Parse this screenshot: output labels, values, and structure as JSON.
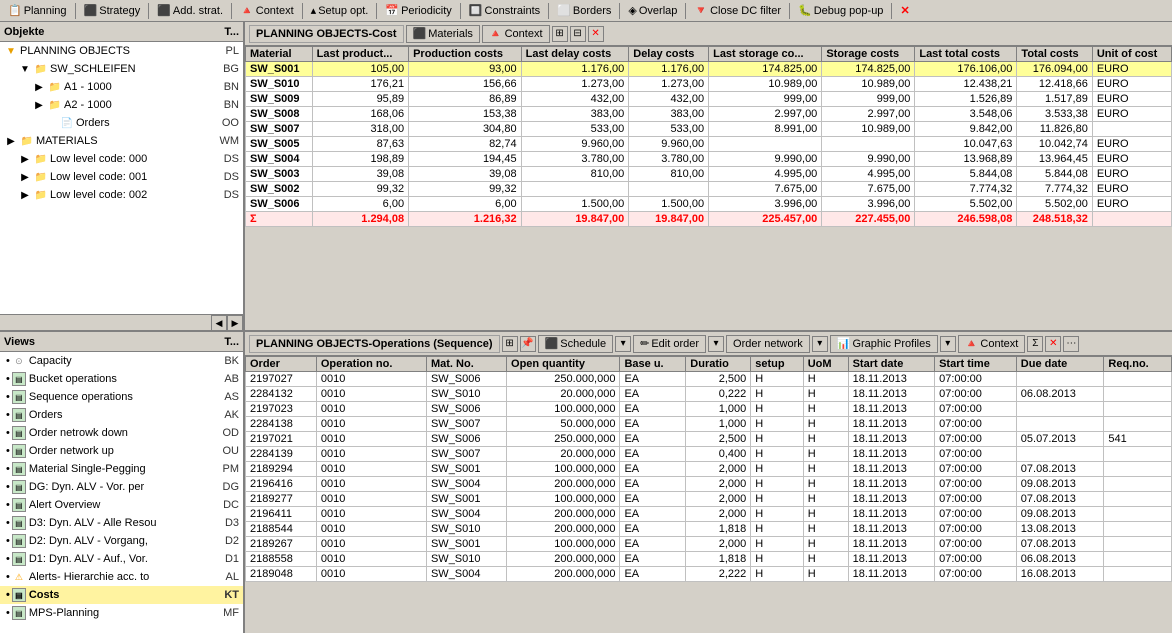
{
  "toolbar": {
    "items": [
      {
        "label": "Planning",
        "icon": "📋"
      },
      {
        "label": "Strategy",
        "icon": "📊"
      },
      {
        "label": "Add. strat.",
        "icon": "📑"
      },
      {
        "label": "Context",
        "icon": "🔺"
      },
      {
        "label": "Setup opt.",
        "icon": "🔺"
      },
      {
        "label": "Periodicity",
        "icon": "📅"
      },
      {
        "label": "Constraints",
        "icon": "🔲"
      },
      {
        "label": "Borders",
        "icon": "⬜"
      },
      {
        "label": "Overlap",
        "icon": "◈"
      },
      {
        "label": "Close DC filter",
        "icon": "🔻"
      },
      {
        "label": "Debug pop-up",
        "icon": "🐛"
      }
    ]
  },
  "left_panel": {
    "objects_header": "Objekte",
    "objects_col": "T...",
    "tree": [
      {
        "label": "PLANNING OBJECTS",
        "code": "PL",
        "indent": 0,
        "type": "root",
        "expanded": true
      },
      {
        "label": "SW_SCHLEIFEN",
        "code": "BG",
        "indent": 1,
        "type": "folder",
        "expanded": true
      },
      {
        "label": "A1 - 1000",
        "code": "BN",
        "indent": 2,
        "type": "folder"
      },
      {
        "label": "A2 - 1000",
        "code": "BN",
        "indent": 2,
        "type": "folder"
      },
      {
        "label": "Orders",
        "code": "OO",
        "indent": 3,
        "type": "orders"
      },
      {
        "label": "MATERIALS",
        "code": "WM",
        "indent": 0,
        "type": "folder",
        "expanded": false
      },
      {
        "label": "Low level code: 000",
        "code": "DS",
        "indent": 1,
        "type": "folder"
      },
      {
        "label": "Low level code: 001",
        "code": "DS",
        "indent": 1,
        "type": "folder"
      },
      {
        "label": "Low level code: 002",
        "code": "DS",
        "indent": 1,
        "type": "folder"
      }
    ],
    "views_header": "Views",
    "views_col": "T...",
    "views": [
      {
        "label": "Capacity",
        "code": "BK",
        "type": "chart",
        "selected": false
      },
      {
        "label": "Bucket operations",
        "code": "AB",
        "type": "doc",
        "selected": false
      },
      {
        "label": "Sequence operations",
        "code": "AS",
        "type": "doc"
      },
      {
        "label": "Orders",
        "code": "AK",
        "type": "doc"
      },
      {
        "label": "Order netrowk down",
        "code": "OD",
        "type": "doc"
      },
      {
        "label": "Order network up",
        "code": "OU",
        "type": "doc"
      },
      {
        "label": "Material Single-Pegging",
        "code": "PM",
        "type": "doc"
      },
      {
        "label": "DG: Dyn. ALV - Vor. per",
        "code": "DG",
        "type": "doc"
      },
      {
        "label": "Alert Overview",
        "code": "DC",
        "type": "doc"
      },
      {
        "label": "D3: Dyn. ALV - Alle Resou",
        "code": "D3",
        "type": "doc"
      },
      {
        "label": "D2: Dyn. ALV - Vorgang,",
        "code": "D2",
        "type": "doc"
      },
      {
        "label": "D1: Dyn. ALV - Auf., Vor.",
        "code": "D1",
        "type": "doc"
      },
      {
        "label": "Alerts- Hierarchie acc. to",
        "code": "AL",
        "type": "warn"
      },
      {
        "label": "Costs",
        "code": "KT",
        "type": "doc",
        "selected": true
      },
      {
        "label": "MPS-Planning",
        "code": "MF",
        "type": "doc"
      }
    ]
  },
  "top_table": {
    "toolbar_title": "PLANNING OBJECTS-Cost",
    "btn_materials": "Materials",
    "btn_context": "Context",
    "columns": [
      "Material",
      "Last product...",
      "Production costs",
      "Last delay costs",
      "Delay costs",
      "Last storage co...",
      "Storage costs",
      "Last total costs",
      "Total costs",
      "Unit of cost"
    ],
    "rows": [
      {
        "mat": "SW_S001",
        "last_prod": "105,00",
        "prod_costs": "93,00",
        "last_delay": "1.176,00",
        "delay": "1.176,00",
        "last_storage": "174.825,00",
        "storage": "174.825,00",
        "last_total": "176.106,00",
        "total": "176.094,00",
        "unit": "EURO",
        "selected": true
      },
      {
        "mat": "SW_S010",
        "last_prod": "176,21",
        "prod_costs": "156,66",
        "last_delay": "1.273,00",
        "delay": "1.273,00",
        "last_storage": "10.989,00",
        "storage": "10.989,00",
        "last_total": "12.438,21",
        "total": "12.418,66",
        "unit": "EURO"
      },
      {
        "mat": "SW_S009",
        "last_prod": "95,89",
        "prod_costs": "86,89",
        "last_delay": "432,00",
        "delay": "432,00",
        "last_storage": "999,00",
        "storage": "999,00",
        "last_total": "1.526,89",
        "total": "1.517,89",
        "unit": "EURO"
      },
      {
        "mat": "SW_S008",
        "last_prod": "168,06",
        "prod_costs": "153,38",
        "last_delay": "383,00",
        "delay": "383,00",
        "last_storage": "2.997,00",
        "storage": "2.997,00",
        "last_total": "3.548,06",
        "total": "3.533,38",
        "unit": "EURO"
      },
      {
        "mat": "SW_S007",
        "last_prod": "318,00",
        "prod_costs": "304,80",
        "last_delay": "533,00",
        "delay": "533,00",
        "last_storage": "8.991,00",
        "storage": "10.989,00",
        "last_total": "9.842,00",
        "total": "11.826,80",
        "unit": ""
      },
      {
        "mat": "SW_S005",
        "last_prod": "87,63",
        "prod_costs": "82,74",
        "last_delay": "9.960,00",
        "delay": "9.960,00",
        "last_storage": "",
        "storage": "",
        "last_total": "10.047,63",
        "total": "10.042,74",
        "unit": "EURO"
      },
      {
        "mat": "SW_S004",
        "last_prod": "198,89",
        "prod_costs": "194,45",
        "last_delay": "3.780,00",
        "delay": "3.780,00",
        "last_storage": "9.990,00",
        "storage": "9.990,00",
        "last_total": "13.968,89",
        "total": "13.964,45",
        "unit": "EURO"
      },
      {
        "mat": "SW_S003",
        "last_prod": "39,08",
        "prod_costs": "39,08",
        "last_delay": "810,00",
        "delay": "810,00",
        "last_storage": "4.995,00",
        "storage": "4.995,00",
        "last_total": "5.844,08",
        "total": "5.844,08",
        "unit": "EURO"
      },
      {
        "mat": "SW_S002",
        "last_prod": "99,32",
        "prod_costs": "99,32",
        "last_delay": "",
        "delay": "",
        "last_storage": "7.675,00",
        "storage": "7.675,00",
        "last_total": "7.774,32",
        "total": "7.774,32",
        "unit": "EURO"
      },
      {
        "mat": "SW_S006",
        "last_prod": "6,00",
        "prod_costs": "6,00",
        "last_delay": "1.500,00",
        "delay": "1.500,00",
        "last_storage": "3.996,00",
        "storage": "3.996,00",
        "last_total": "5.502,00",
        "total": "5.502,00",
        "unit": "EURO"
      }
    ],
    "sum_row": {
      "label": "Σ",
      "last_prod": "1.294,08",
      "prod_costs": "1.216,32",
      "last_delay": "19.847,00",
      "delay": "19.847,00",
      "last_storage": "225.457,00",
      "storage": "227.455,00",
      "last_total": "246.598,08",
      "total": "248.518,32"
    }
  },
  "bottom_table": {
    "toolbar_title": "PLANNING OBJECTS-Operations (Sequence)",
    "btn_schedule": "Schedule",
    "btn_edit_order": "Edit order",
    "btn_order_network": "Order network",
    "btn_graphic_profiles": "Graphic Profiles",
    "btn_context": "Context",
    "columns": [
      "Order",
      "Operation no.",
      "Mat. No.",
      "Open quantity",
      "Base u.",
      "Duratio",
      "setup",
      "UoM",
      "Start date",
      "Start time",
      "Due date",
      "Req.no."
    ],
    "rows": [
      {
        "order": "2197027",
        "op": "0010",
        "mat": "SW_S006",
        "qty": "250.000,000",
        "base": "EA",
        "dur": "2,500",
        "setup": "H",
        "uom": "H",
        "start_date": "18.11.2013",
        "start_time": "07:00:00",
        "due": "",
        "req": ""
      },
      {
        "order": "2284132",
        "op": "0010",
        "mat": "SW_S010",
        "qty": "20.000,000",
        "base": "EA",
        "dur": "0,222",
        "setup": "H",
        "uom": "H",
        "start_date": "18.11.2013",
        "start_time": "07:00:00",
        "due": "06.08.2013",
        "req": ""
      },
      {
        "order": "2197023",
        "op": "0010",
        "mat": "SW_S006",
        "qty": "100.000,000",
        "base": "EA",
        "dur": "1,000",
        "setup": "H",
        "uom": "H",
        "start_date": "18.11.2013",
        "start_time": "07:00:00",
        "due": "",
        "req": ""
      },
      {
        "order": "2284138",
        "op": "0010",
        "mat": "SW_S007",
        "qty": "50.000,000",
        "base": "EA",
        "dur": "1,000",
        "setup": "H",
        "uom": "H",
        "start_date": "18.11.2013",
        "start_time": "07:00:00",
        "due": "",
        "req": ""
      },
      {
        "order": "2197021",
        "op": "0010",
        "mat": "SW_S006",
        "qty": "250.000,000",
        "base": "EA",
        "dur": "2,500",
        "setup": "H",
        "uom": "H",
        "start_date": "18.11.2013",
        "start_time": "07:00:00",
        "due": "05.07.2013",
        "req": "541"
      },
      {
        "order": "2284139",
        "op": "0010",
        "mat": "SW_S007",
        "qty": "20.000,000",
        "base": "EA",
        "dur": "0,400",
        "setup": "H",
        "uom": "H",
        "start_date": "18.11.2013",
        "start_time": "07:00:00",
        "due": "",
        "req": ""
      },
      {
        "order": "2189294",
        "op": "0010",
        "mat": "SW_S001",
        "qty": "100.000,000",
        "base": "EA",
        "dur": "2,000",
        "setup": "H",
        "uom": "H",
        "start_date": "18.11.2013",
        "start_time": "07:00:00",
        "due": "07.08.2013",
        "req": ""
      },
      {
        "order": "2196416",
        "op": "0010",
        "mat": "SW_S004",
        "qty": "200.000,000",
        "base": "EA",
        "dur": "2,000",
        "setup": "H",
        "uom": "H",
        "start_date": "18.11.2013",
        "start_time": "07:00:00",
        "due": "09.08.2013",
        "req": ""
      },
      {
        "order": "2189277",
        "op": "0010",
        "mat": "SW_S001",
        "qty": "100.000,000",
        "base": "EA",
        "dur": "2,000",
        "setup": "H",
        "uom": "H",
        "start_date": "18.11.2013",
        "start_time": "07:00:00",
        "due": "07.08.2013",
        "req": ""
      },
      {
        "order": "2196411",
        "op": "0010",
        "mat": "SW_S004",
        "qty": "200.000,000",
        "base": "EA",
        "dur": "2,000",
        "setup": "H",
        "uom": "H",
        "start_date": "18.11.2013",
        "start_time": "07:00:00",
        "due": "09.08.2013",
        "req": ""
      },
      {
        "order": "2188544",
        "op": "0010",
        "mat": "SW_S010",
        "qty": "200.000,000",
        "base": "EA",
        "dur": "1,818",
        "setup": "H",
        "uom": "H",
        "start_date": "18.11.2013",
        "start_time": "07:00:00",
        "due": "13.08.2013",
        "req": ""
      },
      {
        "order": "2189267",
        "op": "0010",
        "mat": "SW_S001",
        "qty": "100.000,000",
        "base": "EA",
        "dur": "2,000",
        "setup": "H",
        "uom": "H",
        "start_date": "18.11.2013",
        "start_time": "07:00:00",
        "due": "07.08.2013",
        "req": ""
      },
      {
        "order": "2188558",
        "op": "0010",
        "mat": "SW_S010",
        "qty": "200.000,000",
        "base": "EA",
        "dur": "1,818",
        "setup": "H",
        "uom": "H",
        "start_date": "18.11.2013",
        "start_time": "07:00:00",
        "due": "06.08.2013",
        "req": ""
      },
      {
        "order": "2189048",
        "op": "0010",
        "mat": "SW_S004",
        "qty": "200.000,000",
        "base": "EA",
        "dur": "2,222",
        "setup": "H",
        "uom": "H",
        "start_date": "18.11.2013",
        "start_time": "07:00:00",
        "due": "16.08.2013",
        "req": ""
      }
    ]
  }
}
